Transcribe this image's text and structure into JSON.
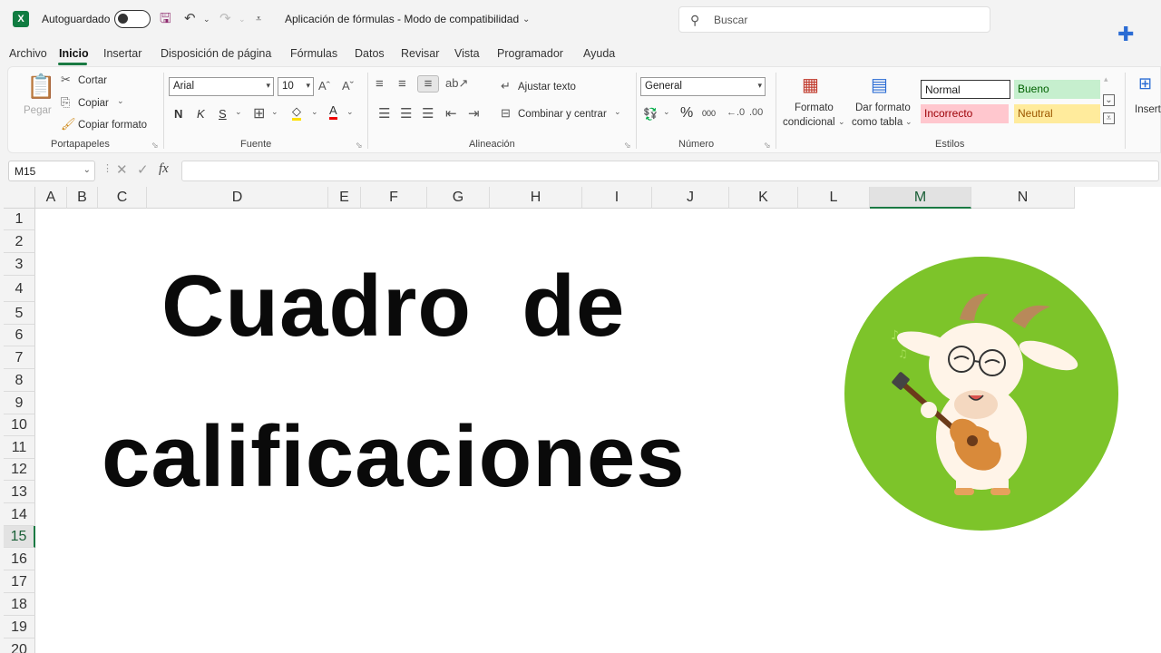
{
  "title_bar": {
    "app_icon": "X",
    "autosave_label": "Autoguardado",
    "doc_title": "Aplicación de fórmulas  -  Modo de compatibilidad",
    "search_placeholder": "Buscar"
  },
  "menu": [
    "Archivo",
    "Inicio",
    "Insertar",
    "Disposición de página",
    "Fórmulas",
    "Datos",
    "Revisar",
    "Vista",
    "Programador",
    "Ayuda"
  ],
  "ribbon": {
    "clipboard": {
      "paste": "Pegar",
      "cut": "Cortar",
      "copy": "Copiar",
      "format_painter": "Copiar formato",
      "label": "Portapapeles"
    },
    "font": {
      "name": "Arial",
      "size": "10",
      "bold": "N",
      "italic": "K",
      "underline": "S",
      "label": "Fuente"
    },
    "alignment": {
      "wrap": "Ajustar texto",
      "merge": "Combinar y centrar",
      "label": "Alineación"
    },
    "number": {
      "format": "General",
      "percent": "%",
      "thousands": "000",
      "label": "Número"
    },
    "styles": {
      "conditional_line1": "Formato",
      "conditional_line2": "condicional",
      "table_line1": "Dar formato",
      "table_line2": "como tabla",
      "normal": "Normal",
      "good": "Bueno",
      "bad": "Incorrecto",
      "neutral": "Neutral",
      "label": "Estilos"
    },
    "cells": {
      "insert": "Insertar"
    }
  },
  "formula_bar": {
    "name_box": "M15",
    "fx": "fx"
  },
  "columns": [
    "A",
    "B",
    "C",
    "D",
    "E",
    "F",
    "G",
    "H",
    "I",
    "J",
    "K",
    "L",
    "M",
    "N"
  ],
  "rows": [
    "1",
    "2",
    "3",
    "4",
    "5",
    "6",
    "7",
    "8",
    "9",
    "10",
    "11",
    "12",
    "13",
    "14",
    "15",
    "16",
    "17",
    "18",
    "19",
    "20"
  ],
  "content": {
    "line1": "Cuadro  de",
    "line2": "calificaciones"
  },
  "colors": {
    "accent": "#1a7a43",
    "goat_bg": "#7dc42a",
    "good_bg": "#c6efce",
    "bad_bg": "#ffc7ce",
    "neutral_bg": "#ffeb9c"
  }
}
